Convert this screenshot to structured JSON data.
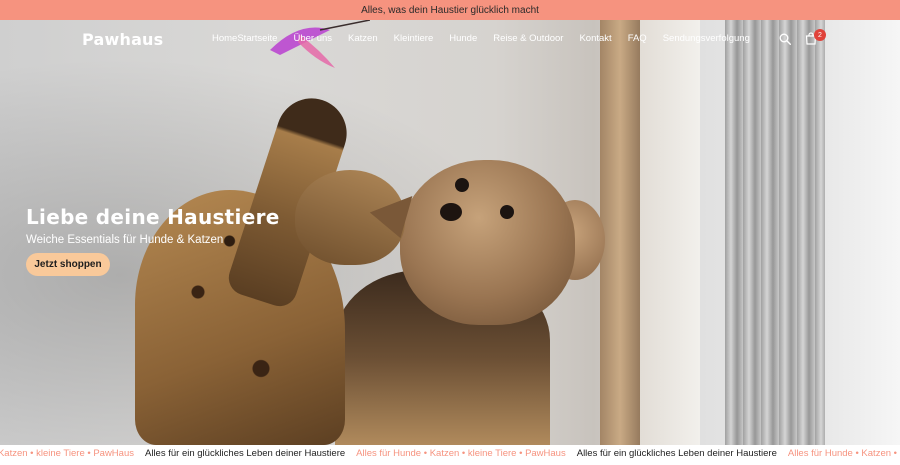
{
  "announcement": "Alles, was dein Haustier glücklich macht",
  "brand": {
    "logo_text": "Pawhaus"
  },
  "nav": {
    "items": [
      "HomeStartseite",
      "Über uns",
      "Katzen",
      "Kleintiere",
      "Hunde",
      "Reise & Outdoor",
      "Kontakt",
      "FAQ",
      "Sendungsverfolgung"
    ]
  },
  "header_icons": {
    "search": "search-icon",
    "cart": "bag-icon",
    "cart_count": "2"
  },
  "hero": {
    "title": "Liebe deine Haustiere",
    "subtitle": "Weiche Essentials für Hunde & Katzen",
    "cta_label": "Jetzt shoppen"
  },
  "marquee": [
    {
      "text": "• Katzen • kleine Tiere • PawHaus",
      "style": "accent"
    },
    {
      "text": "Alles für ein glückliches Leben deiner Haustiere",
      "style": "dark"
    },
    {
      "text": "Alles für Hunde • Katzen • kleine Tiere • PawHaus",
      "style": "accent"
    },
    {
      "text": "Alles für ein glückliches Leben deiner Haustiere",
      "style": "dark"
    },
    {
      "text": "Alles für Hunde • Katzen • kleine",
      "style": "accent"
    }
  ],
  "colors": {
    "announcement_bg": "#f6937f",
    "cta_bg": "#f9c99a",
    "badge": "#e0423a",
    "marquee_accent": "#f6937f"
  }
}
